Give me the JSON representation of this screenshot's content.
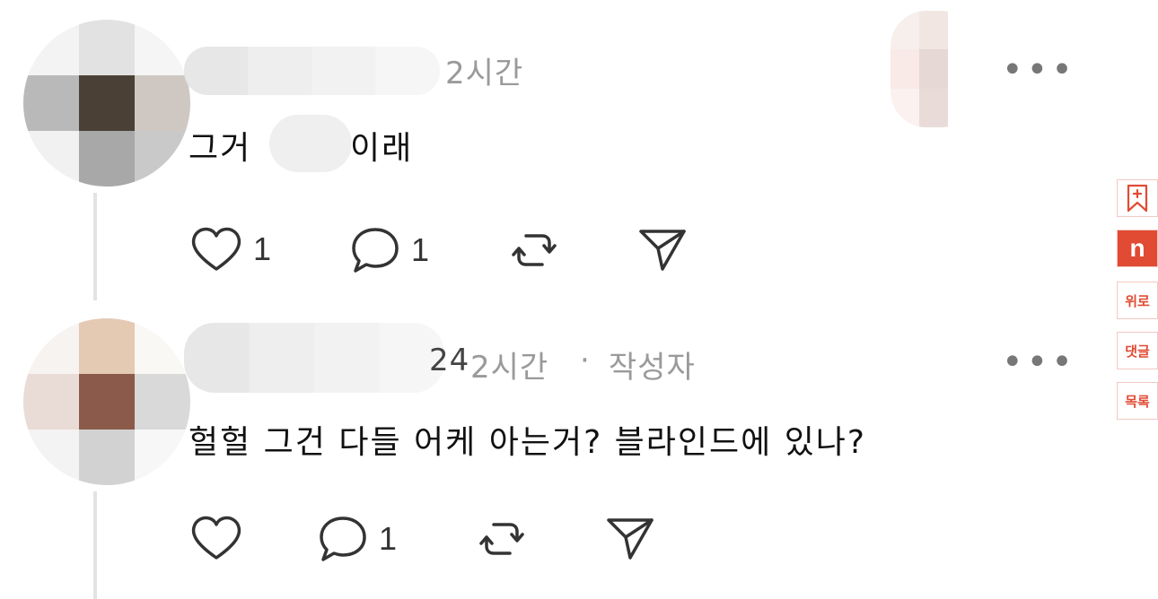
{
  "comments": [
    {
      "time": "2시간",
      "author_tag": "",
      "text_start": "그거",
      "text_end": "이래",
      "actions": {
        "like_count": "1",
        "reply_count": "1"
      }
    },
    {
      "time": "2시간",
      "separator": "·",
      "author_tag": "작성자",
      "username_tail": "24",
      "text": "헐헐 그건 다들 어케 아는거? 블라인드에 있나?",
      "actions": {
        "like_count": "",
        "reply_count": "1"
      }
    }
  ],
  "more_label": "•••",
  "sidebar": {
    "bookmark_icon": "bookmark-plus-icon",
    "brand_letter": "n",
    "up_label": "위로",
    "comment_label": "댓글",
    "list_label": "목록"
  },
  "colors": {
    "accent": "#e14b33",
    "meta": "#9a9a9a"
  }
}
